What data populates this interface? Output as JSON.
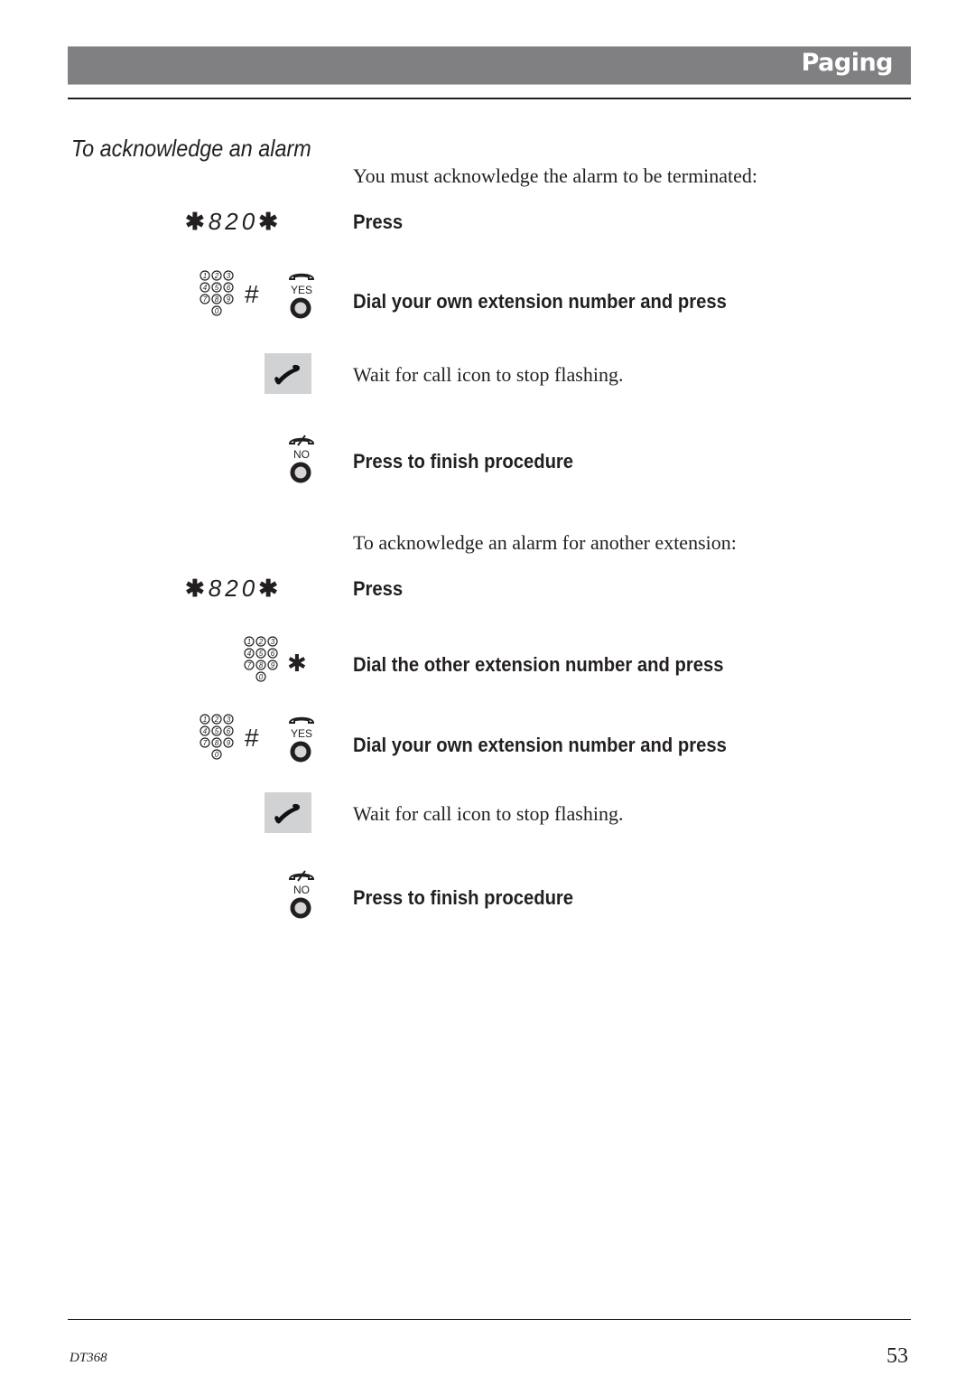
{
  "header": {
    "title": "Paging"
  },
  "section": {
    "title": "To acknowledge an alarm"
  },
  "part1": {
    "intro": "You must acknowledge the alarm to be terminated:",
    "steps": [
      {
        "key_code": {
          "star": "✱",
          "digits": "820"
        },
        "text": "Press"
      },
      {
        "keys": [
          "keypad-icon",
          "#",
          "yes-button-icon"
        ],
        "yes_label": "YES",
        "hash": "#",
        "text": "Dial your own extension number and press"
      },
      {
        "keys": [
          "call-indicator-icon"
        ],
        "text": "Wait for call icon to stop flashing."
      },
      {
        "keys": [
          "no-button-icon"
        ],
        "no_label": "NO",
        "text": "Press to finish procedure"
      }
    ]
  },
  "part2": {
    "intro": "To acknowledge an alarm for another extension:",
    "steps": [
      {
        "key_code": {
          "star": "✱",
          "digits": "820"
        },
        "text": "Press"
      },
      {
        "keys": [
          "keypad-icon",
          "*"
        ],
        "star": "✱",
        "text": "Dial the other extension number and press"
      },
      {
        "keys": [
          "keypad-icon",
          "#",
          "yes-button-icon"
        ],
        "yes_label": "YES",
        "hash": "#",
        "text": "Dial your own extension number and press"
      },
      {
        "keys": [
          "call-indicator-icon"
        ],
        "text": "Wait for call icon to stop flashing."
      },
      {
        "keys": [
          "no-button-icon"
        ],
        "no_label": "NO",
        "text": "Press to finish procedure"
      }
    ]
  },
  "keypad": {
    "digits": [
      "1",
      "2",
      "3",
      "4",
      "5",
      "6",
      "7",
      "8",
      "9",
      "0"
    ]
  },
  "footer": {
    "model": "DT368",
    "page_number": "53"
  }
}
